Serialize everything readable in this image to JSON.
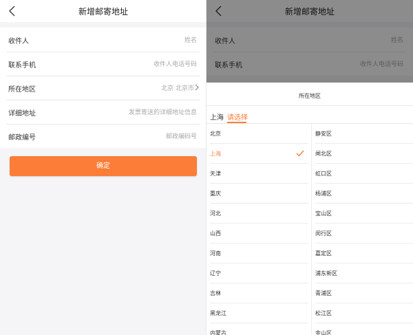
{
  "nav": {
    "title": "新增邮寄地址"
  },
  "form": {
    "rows": [
      {
        "label": "收件人",
        "value": "姓名"
      },
      {
        "label": "联系手机",
        "value": "收件人电话号码"
      },
      {
        "label": "所在地区",
        "value": "北京 北京市"
      },
      {
        "label": "详细地址",
        "value": "发票寄送的详细地址信息"
      },
      {
        "label": "邮政编号",
        "value": "邮政编码号"
      }
    ]
  },
  "confirm_label": "确定",
  "picker": {
    "title": "所在地区",
    "crumbs": {
      "first": "上海",
      "active": "请选择"
    },
    "provinces": [
      "北京",
      "上海",
      "天津",
      "重庆",
      "河北",
      "山西",
      "河南",
      "辽宁",
      "吉林",
      "黑龙江",
      "内蒙古"
    ],
    "selected_province": "上海",
    "districts": [
      "静安区",
      "闸北区",
      "虹口区",
      "杨浦区",
      "宝山区",
      "闵行区",
      "嘉定区",
      "浦东新区",
      "青浦区",
      "松江区",
      "金山区"
    ]
  },
  "colors": {
    "accent": "#fb7d37"
  },
  "icons": {
    "back": "chevron-left-icon",
    "arrow": "chevron-right-icon",
    "check": "checkmark-icon"
  }
}
